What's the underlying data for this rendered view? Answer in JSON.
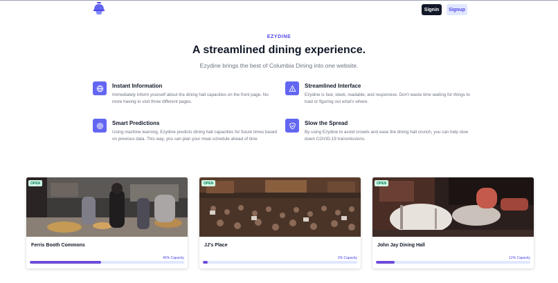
{
  "header": {
    "logo_icon": "food-cloche-icon",
    "signin_label": "Signin",
    "signup_label": "Signup"
  },
  "hero": {
    "eyebrow": "EZYDINE",
    "title": "A streamlined dining experience.",
    "subtitle": "Ezydine brings the best of Columbia Dining into one website."
  },
  "features": [
    {
      "icon": "globe-icon",
      "title": "Instant Information",
      "description": "Immediately inform yourself about the dining hall capacities on the front page. No more having to visit three different pages."
    },
    {
      "icon": "triangle-icon",
      "title": "Streamlined Interface",
      "description": "Ezydine is fast, sleek, readable, and responsive. Don't waste time waiting for things to load or figuring out what's where."
    },
    {
      "icon": "target-icon",
      "title": "Smart Predictions",
      "description": "Using machine learning, Ezydine predicts dining hall capacities for future times based on previous data. This way, you can plan your meal schedule ahead of time"
    },
    {
      "icon": "shield-icon",
      "title": "Slow the Spread",
      "description": "By using Ezydine to avoid crowds and ease the dining hall crunch, you can help slow down COVID-19 transmissions."
    }
  ],
  "halls": [
    {
      "name": "Ferris Booth Commons",
      "status": "OPEN",
      "capacity_label": "46% Capacity",
      "capacity_pct": 46
    },
    {
      "name": "JJ's Place",
      "status": "OPEN",
      "capacity_label": "3% Capacity",
      "capacity_pct": 3
    },
    {
      "name": "John Jay Dining Hall",
      "status": "OPEN",
      "capacity_label": "12% Capacity",
      "capacity_pct": 12
    }
  ],
  "colors": {
    "accent": "#6366f1",
    "progress": "#6d4bd8",
    "open_badge_bg": "#d1fae5",
    "open_badge_text": "#047857"
  }
}
